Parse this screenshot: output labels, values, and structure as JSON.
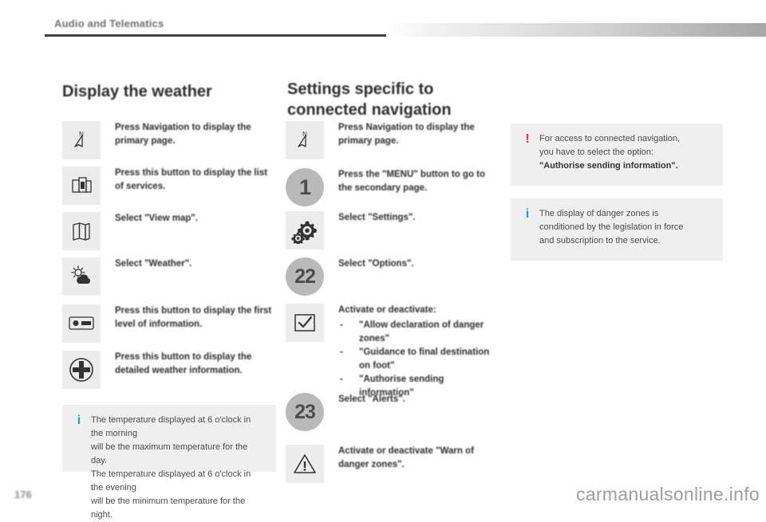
{
  "header": {
    "breadcrumb": "Audio and Telematics"
  },
  "footer": {
    "page_number": "176",
    "watermark": "carmanualsonline.info"
  },
  "column_left": {
    "title": "Display the weather",
    "steps": [
      {
        "icon": "navigation-arrow-icon",
        "icon_style": "square",
        "text": "Press Navigation to display the primary page."
      },
      {
        "icon": "services-list-icon",
        "icon_style": "square",
        "text": "Press this button to display the list of services."
      },
      {
        "icon": "map-icon",
        "icon_style": "square",
        "text": "Select \"View map\"."
      },
      {
        "icon": "weather-sun-cloud-icon",
        "icon_style": "square",
        "text": "Select \"Weather\"."
      },
      {
        "icon": "info-level-icon",
        "icon_style": "square",
        "text": "Press this button to display the first level of information."
      },
      {
        "icon": "plus-circle-icon",
        "icon_style": "square",
        "text": "Press this button to display the detailed weather information."
      }
    ],
    "note": {
      "mark": "i",
      "mark_type": "info",
      "lines": [
        "The temperature displayed at 6 o'clock in the morning",
        "will be the maximum temperature for the day.",
        "The temperature displayed at 6 o'clock in the evening",
        "will be the minimum temperature for the night."
      ]
    }
  },
  "column_middle": {
    "title_line1": "Settings specific to",
    "title_line2": "connected navigation",
    "steps": [
      {
        "icon": "navigation-arrow-icon",
        "icon_style": "square",
        "text": "Press Navigation to display the primary page."
      },
      {
        "icon": "step-number-badge",
        "icon_style": "circle",
        "badge": "1",
        "text": "Press the \"MENU\" button to go to the secondary page."
      },
      {
        "icon": "settings-gears-icon",
        "icon_style": "square",
        "text": "Select \"Settings\"."
      },
      {
        "icon": "step-number-badge",
        "icon_style": "circle",
        "badge": "22",
        "text": "Select \"Options\"."
      },
      {
        "icon": "checkbox-icon",
        "icon_style": "square",
        "text": "Activate or deactivate:",
        "sub_items": [
          "\"Allow declaration of danger zones\"",
          "\"Guidance to final destination on foot\"",
          "\"Authorise sending information\""
        ]
      },
      {
        "icon": "step-number-badge",
        "icon_style": "circle",
        "badge": "23",
        "text": "Select \"Alerts\"."
      },
      {
        "icon": "warning-triangle-icon",
        "icon_style": "square",
        "text": "Activate or deactivate \"Warn of danger zones\"."
      }
    ]
  },
  "column_right": {
    "notes": [
      {
        "mark": "!",
        "mark_type": "warn",
        "lines": [
          "For access to connected navigation,",
          "you have to select the option:"
        ],
        "bold_line": "\"Authorise sending information\"."
      },
      {
        "mark": "i",
        "mark_type": "info",
        "lines": [
          "The display of danger zones is",
          "conditioned by the legislation in force",
          "and subscription to the service."
        ]
      }
    ]
  },
  "colors": {
    "info_blue": "#1b9fd8",
    "warn_red": "#e8343c",
    "box_grey": "#efefef",
    "icon_grey": "#ececec",
    "badge_grey": "#b9b9b9"
  }
}
